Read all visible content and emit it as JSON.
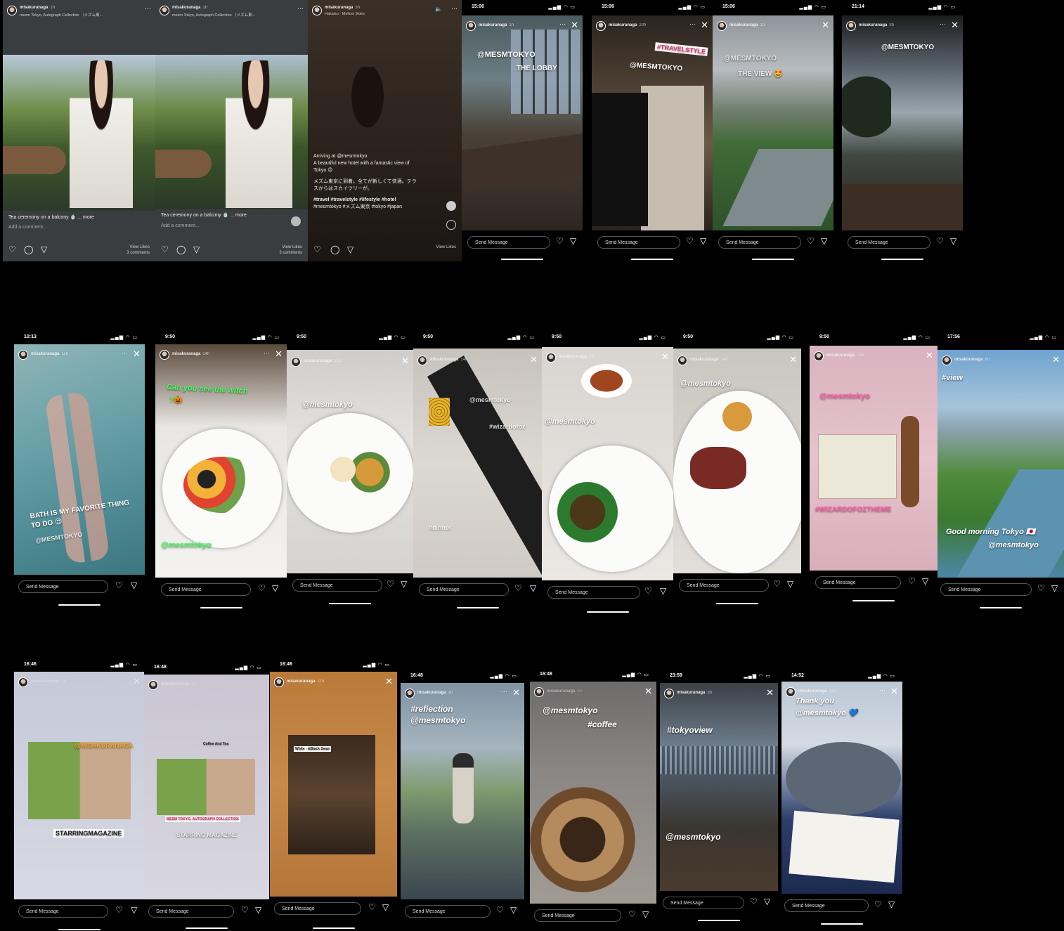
{
  "colors": {
    "bg": "#000000",
    "accent_pink": "#ff5fa2",
    "accent_green": "#43ff5a"
  },
  "posts": [
    {
      "user": "misakuranaga",
      "ago": "1h",
      "location": "mesm Tokyo, Autograph Collection （メズム東...",
      "caption": "Tea ceremony on a balcony 🍵 ... more",
      "comment_placeholder": "Add a comment...",
      "view_likes": "View Likes",
      "comments": "3 comments"
    },
    {
      "user": "misakuranaga",
      "ago": "1h",
      "location": "mesm Tokyo, Autograph Collection （メズム東...",
      "caption": "Tea ceremony on a balcony 🍵 ... more",
      "comment_placeholder": "Add a comment...",
      "view_likes": "View Likes",
      "comments": "3 comments"
    },
    {
      "user": "misakuranaga",
      "ago": "3h",
      "location": "Hakaisu - Mellow Skies",
      "caption_lines": [
        "Arriving at @mesmtokyo",
        "A beautiful new hotel with a fantastic view of",
        "Tokyo 😍",
        "",
        "メズム東京に到着。全てが新しくて快適。テラ",
        "スからはスカイツリーが。",
        "",
        "#travel #travelstyle #lifestyle #hotel",
        "#mesmtokyo #メズム東京 #tokyo #japan"
      ],
      "view_likes": "View Likes"
    }
  ],
  "row1_stories": [
    {
      "time": "15:06",
      "user": "misakuranaga",
      "ago": "1h",
      "texts": [
        "@MESMTOKYO",
        "THE LOBBY"
      ],
      "send": "Send Message"
    },
    {
      "time": "15:06",
      "user": "misakuranaga",
      "ago": "20h",
      "texts": [
        "#TRAVELSTYLE",
        "@MESMTOKYO"
      ],
      "send": "Send Message"
    },
    {
      "time": "15:06",
      "user": "misakuranaga",
      "ago": "1h",
      "texts": [
        "@MESMTOKYO",
        "THE VIEW 🤩"
      ],
      "send": "Send Message"
    },
    {
      "time": "21:14",
      "user": "misakuranaga",
      "ago": "3h",
      "texts": [
        "@MESMTOKYO"
      ],
      "send": "Send Message"
    }
  ],
  "row2_stories": [
    {
      "time": "10:13",
      "user": "misakuranaga",
      "ago": "11h",
      "texts": [
        "BATH IS MY FAVORITE THING",
        "TO DO 😍",
        "@MESMTOKYO"
      ],
      "send": "Send Message"
    },
    {
      "time": "9:50",
      "user": "misakuranaga",
      "ago": "14h",
      "texts": [
        "Can you see the witch",
        "?🎃",
        "@mesmtokyo"
      ],
      "send": "Send Message"
    },
    {
      "time": "9:50",
      "user": "misakuranaga",
      "ago": "11h",
      "texts": [
        "@mesmtokyo"
      ],
      "send": "Send Message"
    },
    {
      "time": "9:50",
      "user": "misakuranaga",
      "ago": "14h",
      "texts": [
        "@mesmtokyo",
        "#wizardofoz",
        "#dinner"
      ],
      "send": "Send Message"
    },
    {
      "time": "9:50",
      "user": "misakuranaga",
      "ago": "1h",
      "texts": [
        "@mesmtokyo"
      ],
      "send": "Send Message"
    },
    {
      "time": "9:50",
      "user": "misakuranaga",
      "ago": "14h",
      "texts": [
        "@mesmtokyo"
      ],
      "send": "Send Message"
    },
    {
      "time": "9:50",
      "user": "misakuranaga",
      "ago": "14h",
      "texts": [
        "@mesmtokyo",
        "#WIZARDOFOZTHEME"
      ],
      "send": "Send Message"
    },
    {
      "time": "17:56",
      "user": "misakuranaga",
      "ago": "8h",
      "texts": [
        "#view",
        "Good morning Tokyo 🇯🇵",
        "@mesmtokyo"
      ],
      "send": "Send Message"
    }
  ],
  "row3_stories": [
    {
      "time": "16:46",
      "user": "misakuranaga",
      "ago": "1h",
      "texts": [
        "@MISAKURANAGA",
        "STARRINGMAGAZINE"
      ],
      "send": "Send Message"
    },
    {
      "time": "16:48",
      "user": "misakuranaga",
      "ago": "1h",
      "texts": [
        "Coffee And Tea",
        "MESM TOKYO, AUTOGRAPH COLLECTION",
        "STARRING MAGAZINE"
      ],
      "send": "Send Message"
    },
    {
      "time": "16:46",
      "user": "misakuranaga",
      "ago": "11h",
      "texts": [
        "White - &Black Swan"
      ],
      "send": "Send Message"
    },
    {
      "time": "16:48",
      "user": "misakuranaga",
      "ago": "3h",
      "texts": [
        "#reflection",
        "@mesmtokyo"
      ],
      "send": "Send Message"
    },
    {
      "time": "16:48",
      "user": "misakuranaga",
      "ago": "3h",
      "texts": [
        "@mesmtokyo",
        "#coffee"
      ],
      "send": "Send Message"
    },
    {
      "time": "23:59",
      "user": "misakuranaga",
      "ago": "3h",
      "texts": [
        "#tokyoview",
        "@mesmtokyo"
      ],
      "send": "Send Message"
    },
    {
      "time": "14:52",
      "user": "misakuranaga",
      "ago": "13h",
      "texts": [
        "Thank you",
        "@mesmtokyo 💙"
      ],
      "send": "Send Message"
    }
  ],
  "status_icons": "▂▄▆ ◠ ▭"
}
